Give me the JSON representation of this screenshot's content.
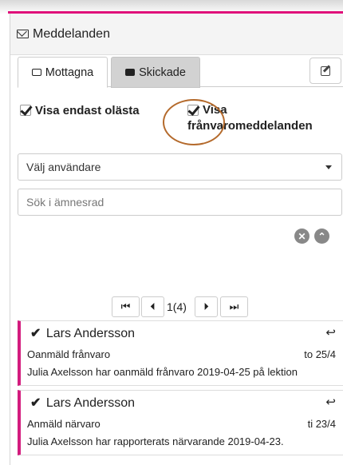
{
  "header": {
    "title": "Meddelanden"
  },
  "tabs": {
    "inbox": "Mottagna",
    "sent": "Skickade"
  },
  "filters": {
    "unread_only": {
      "label": "Visa endast olästa",
      "checked": true
    },
    "absence": {
      "label_line1": "Visa",
      "label_line2": "frånvaromeddelanden",
      "checked": true
    }
  },
  "user_select": {
    "value": "Välj användare"
  },
  "search": {
    "placeholder": "Sök i ämnesrad"
  },
  "pager": {
    "first": "⏮",
    "prev": "⏴",
    "status": "1(4)",
    "next": "⏵",
    "last": "⏭"
  },
  "messages": [
    {
      "sender": "Lars Andersson",
      "subject": "Oanmäld frånvaro",
      "date": "to 25/4",
      "preview": "Julia Axelsson har oanmäld frånvaro 2019-04-25 på lektion"
    },
    {
      "sender": "Lars Andersson",
      "subject": "Anmäld närvaro",
      "date": "ti 23/4",
      "preview": "Julia Axelsson har rapporterats närvarande 2019-04-23."
    }
  ],
  "colors": {
    "accent": "#d31c7e",
    "annotation_circle": "#b46a2c"
  }
}
